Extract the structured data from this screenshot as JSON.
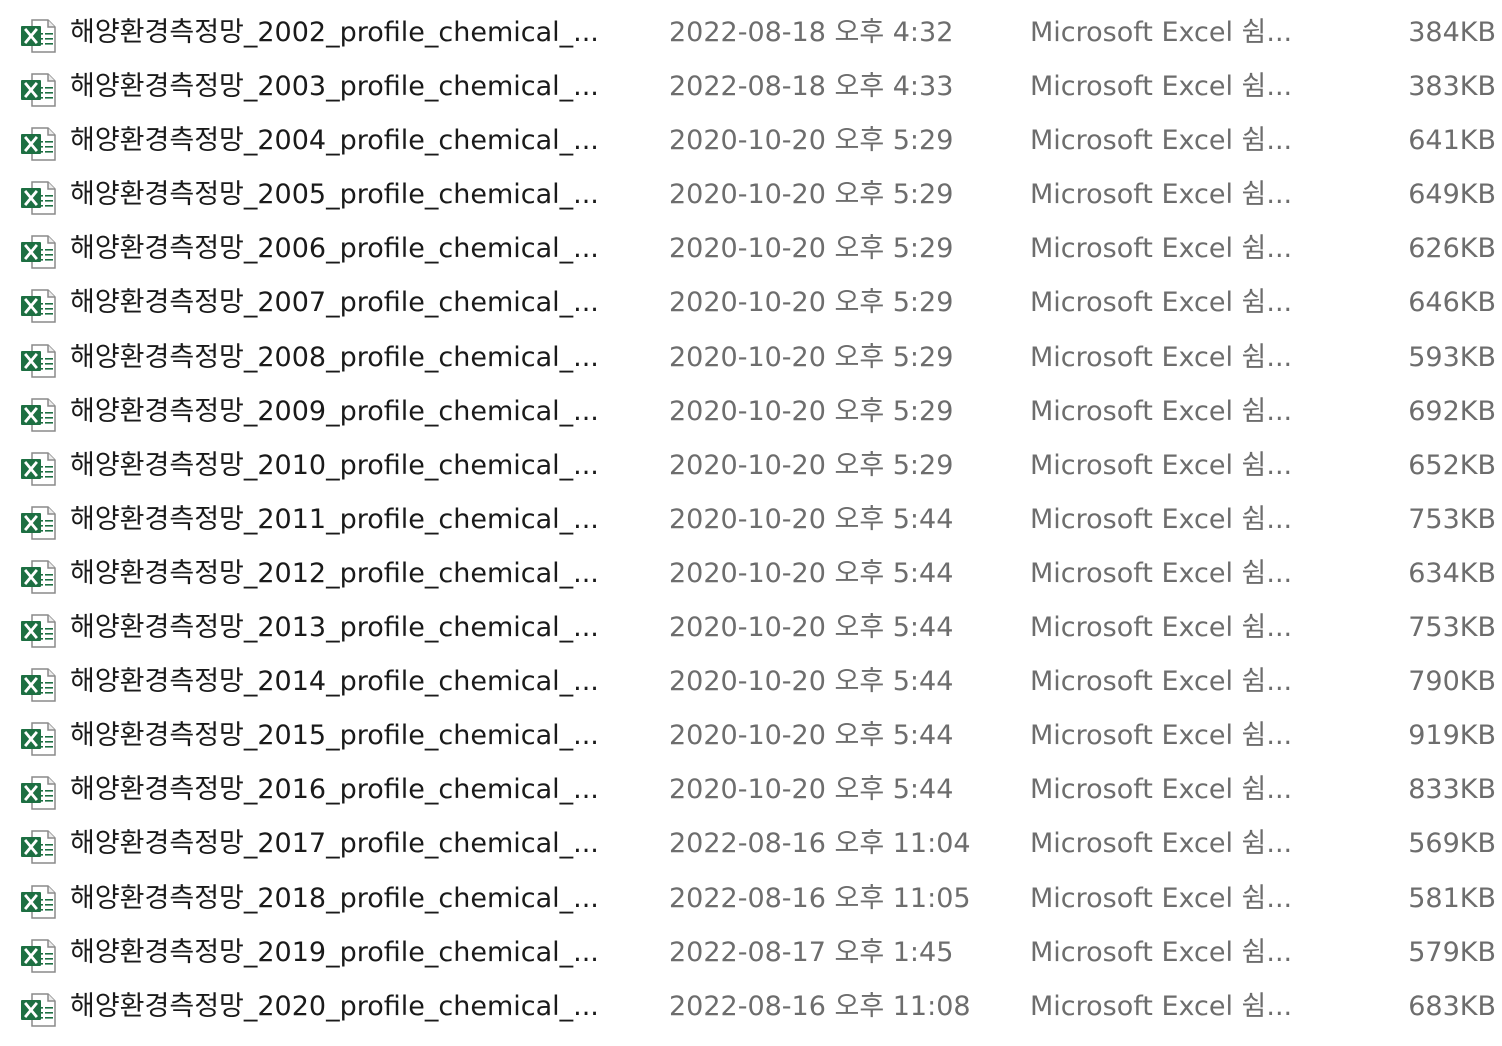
{
  "icon": "excel-file-icon",
  "colors": {
    "excel_green": "#1d6f42",
    "name_text": "#1a1a1a",
    "meta_text": "#6d6d6d"
  },
  "files": [
    {
      "name": "해양환경측정망_2002_profile_chemical_...",
      "date": "2022-08-18 오후 4:32",
      "type": "Microsoft Excel 쉼...",
      "size": "384KB"
    },
    {
      "name": "해양환경측정망_2003_profile_chemical_...",
      "date": "2022-08-18 오후 4:33",
      "type": "Microsoft Excel 쉼...",
      "size": "383KB"
    },
    {
      "name": "해양환경측정망_2004_profile_chemical_...",
      "date": "2020-10-20 오후 5:29",
      "type": "Microsoft Excel 쉼...",
      "size": "641KB"
    },
    {
      "name": "해양환경측정망_2005_profile_chemical_...",
      "date": "2020-10-20 오후 5:29",
      "type": "Microsoft Excel 쉼...",
      "size": "649KB"
    },
    {
      "name": "해양환경측정망_2006_profile_chemical_...",
      "date": "2020-10-20 오후 5:29",
      "type": "Microsoft Excel 쉼...",
      "size": "626KB"
    },
    {
      "name": "해양환경측정망_2007_profile_chemical_...",
      "date": "2020-10-20 오후 5:29",
      "type": "Microsoft Excel 쉼...",
      "size": "646KB"
    },
    {
      "name": "해양환경측정망_2008_profile_chemical_...",
      "date": "2020-10-20 오후 5:29",
      "type": "Microsoft Excel 쉼...",
      "size": "593KB"
    },
    {
      "name": "해양환경측정망_2009_profile_chemical_...",
      "date": "2020-10-20 오후 5:29",
      "type": "Microsoft Excel 쉼...",
      "size": "692KB"
    },
    {
      "name": "해양환경측정망_2010_profile_chemical_...",
      "date": "2020-10-20 오후 5:29",
      "type": "Microsoft Excel 쉼...",
      "size": "652KB"
    },
    {
      "name": "해양환경측정망_2011_profile_chemical_...",
      "date": "2020-10-20 오후 5:44",
      "type": "Microsoft Excel 쉼...",
      "size": "753KB"
    },
    {
      "name": "해양환경측정망_2012_profile_chemical_...",
      "date": "2020-10-20 오후 5:44",
      "type": "Microsoft Excel 쉼...",
      "size": "634KB"
    },
    {
      "name": "해양환경측정망_2013_profile_chemical_...",
      "date": "2020-10-20 오후 5:44",
      "type": "Microsoft Excel 쉼...",
      "size": "753KB"
    },
    {
      "name": "해양환경측정망_2014_profile_chemical_...",
      "date": "2020-10-20 오후 5:44",
      "type": "Microsoft Excel 쉼...",
      "size": "790KB"
    },
    {
      "name": "해양환경측정망_2015_profile_chemical_...",
      "date": "2020-10-20 오후 5:44",
      "type": "Microsoft Excel 쉼...",
      "size": "919KB"
    },
    {
      "name": "해양환경측정망_2016_profile_chemical_...",
      "date": "2020-10-20 오후 5:44",
      "type": "Microsoft Excel 쉼...",
      "size": "833KB"
    },
    {
      "name": "해양환경측정망_2017_profile_chemical_...",
      "date": "2022-08-16 오후 11:04",
      "type": "Microsoft Excel 쉼...",
      "size": "569KB"
    },
    {
      "name": "해양환경측정망_2018_profile_chemical_...",
      "date": "2022-08-16 오후 11:05",
      "type": "Microsoft Excel 쉼...",
      "size": "581KB"
    },
    {
      "name": "해양환경측정망_2019_profile_chemical_...",
      "date": "2022-08-17 오후 1:45",
      "type": "Microsoft Excel 쉼...",
      "size": "579KB"
    },
    {
      "name": "해양환경측정망_2020_profile_chemical_...",
      "date": "2022-08-16 오후 11:08",
      "type": "Microsoft Excel 쉼...",
      "size": "683KB"
    }
  ]
}
